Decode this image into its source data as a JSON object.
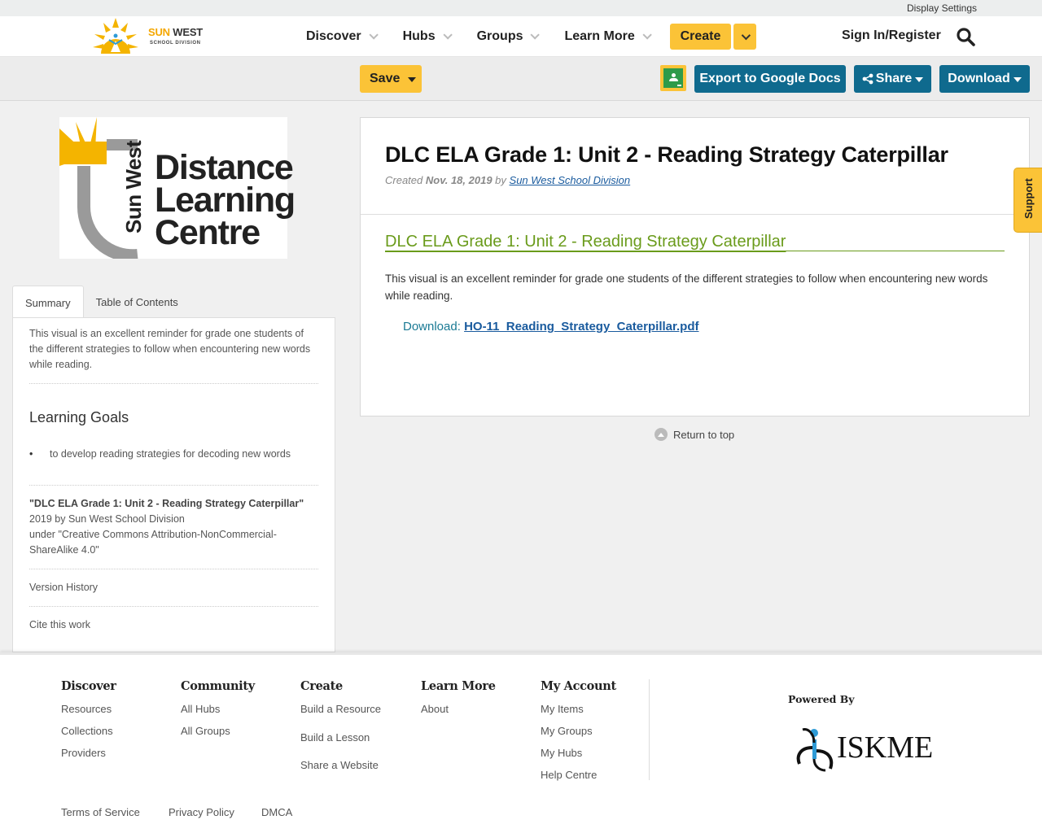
{
  "utility": {
    "display_settings": "Display Settings"
  },
  "brand": {
    "sun": "SUN",
    "west": "WEST",
    "division": "SCHOOL DIVISION"
  },
  "nav": {
    "items": [
      "Discover",
      "Hubs",
      "Groups",
      "Learn More"
    ],
    "create": "Create",
    "signin": "Sign In/Register"
  },
  "toolbar": {
    "save": "Save",
    "export": "Export to Google Docs",
    "share": "Share",
    "download": "Download"
  },
  "left_logo": {
    "line1": "Distance",
    "line2": "Learning",
    "line3": "Centre",
    "vertical": "Sun West"
  },
  "tabs": {
    "summary": "Summary",
    "toc": "Table of Contents"
  },
  "summary": {
    "text": "This visual is an excellent reminder for grade one students of the different strategies to follow when encountering new words while reading.",
    "goals_title": "Learning Goals",
    "goals": [
      "to develop reading strategies for decoding new words"
    ],
    "attr_title": "\"DLC ELA Grade 1: Unit 2 - Reading Strategy Caterpillar\"",
    "attr_line2": "2019 by Sun West School Division",
    "attr_line3": "under \"Creative Commons Attribution-NonCommercial-ShareAlike 4.0\"",
    "version_history": "Version History",
    "cite": "Cite this work"
  },
  "resource": {
    "title": "DLC ELA Grade 1: Unit 2 - Reading Strategy Caterpillar",
    "created_label": "Created",
    "created_date": "Nov. 18, 2019",
    "by_label": "by",
    "author": "Sun West School Division",
    "section_title": "DLC ELA Grade 1: Unit 2 - Reading Strategy Caterpillar",
    "description": "This visual is an excellent reminder for grade one students of the different strategies to follow when encountering new words while reading.",
    "download_label": "Download:",
    "download_file": "HO-11_Reading_Strategy_Caterpillar.pdf"
  },
  "return_top": "Return to top",
  "support": "Support",
  "footer": {
    "discover": {
      "title": "Discover",
      "links": [
        "Resources",
        "Collections",
        "Providers"
      ]
    },
    "community": {
      "title": "Community",
      "links": [
        "All Hubs",
        "All Groups"
      ]
    },
    "create": {
      "title": "Create",
      "links": [
        "Build a Resource",
        "Build a Lesson",
        "Share a Website"
      ]
    },
    "learn": {
      "title": "Learn More",
      "links": [
        "About"
      ]
    },
    "account": {
      "title": "My Account",
      "links": [
        "My Items",
        "My Groups",
        "My Hubs",
        "Help Centre"
      ]
    },
    "powered_by": "Powered By",
    "iskme": "ISKME",
    "legal": [
      "Terms of Service",
      "Privacy Policy",
      "DMCA"
    ]
  },
  "colors": {
    "accent_yellow": "#fbc337",
    "primary_teal": "#0f6a8e",
    "section_green": "#6a9b1b",
    "link_blue": "#1a5b9e"
  }
}
